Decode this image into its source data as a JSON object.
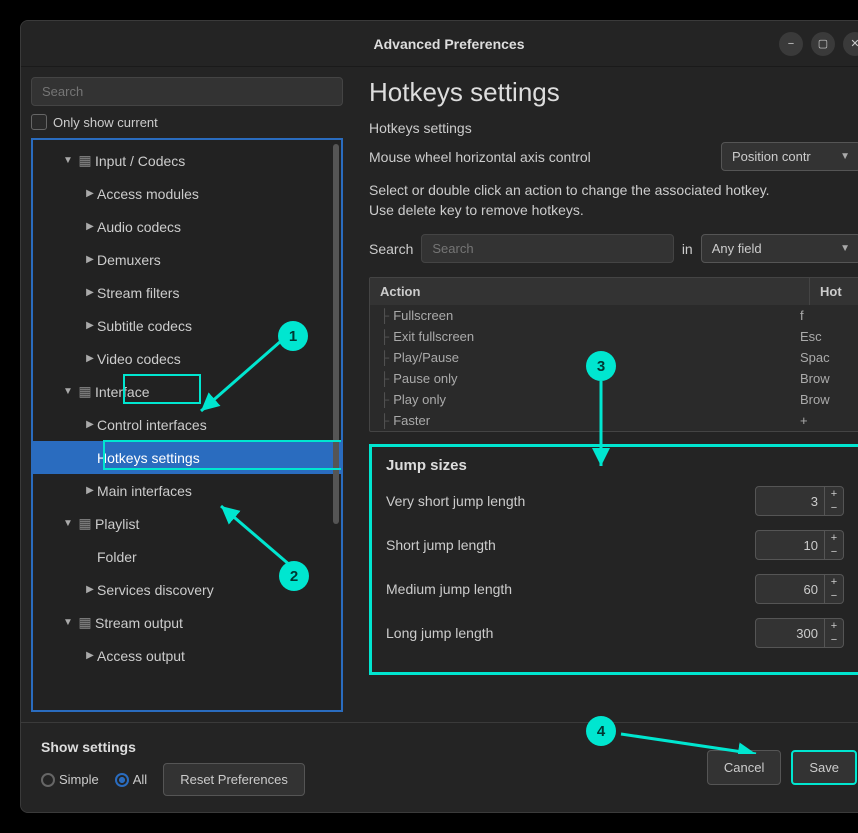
{
  "window_title": "Advanced Preferences",
  "sidebar": {
    "search_placeholder": "Search",
    "only_show_current": "Only show current",
    "tree": [
      {
        "label": "Input / Codecs",
        "expanded": true,
        "indent": 1,
        "icon": "codec"
      },
      {
        "label": "Access modules",
        "indent": 2,
        "arrow": true
      },
      {
        "label": "Audio codecs",
        "indent": 2,
        "arrow": true
      },
      {
        "label": "Demuxers",
        "indent": 2,
        "arrow": true
      },
      {
        "label": "Stream filters",
        "indent": 2,
        "arrow": true
      },
      {
        "label": "Subtitle codecs",
        "indent": 2,
        "arrow": true
      },
      {
        "label": "Video codecs",
        "indent": 2,
        "arrow": true
      },
      {
        "label": "Interface",
        "expanded": true,
        "indent": 1,
        "icon": "interface",
        "highlight": 1
      },
      {
        "label": "Control interfaces",
        "indent": 2,
        "arrow": true
      },
      {
        "label": "Hotkeys settings",
        "indent": 2,
        "selected": true,
        "highlight": 2
      },
      {
        "label": "Main interfaces",
        "indent": 2,
        "arrow": true
      },
      {
        "label": "Playlist",
        "expanded": true,
        "indent": 1,
        "icon": "playlist"
      },
      {
        "label": "Folder",
        "indent": 2
      },
      {
        "label": "Services discovery",
        "indent": 2,
        "arrow": true
      },
      {
        "label": "Stream output",
        "expanded": true,
        "indent": 1,
        "icon": "stream"
      },
      {
        "label": "Access output",
        "indent": 2,
        "arrow": true
      }
    ]
  },
  "main": {
    "title": "Hotkeys settings",
    "subtitle": "Hotkeys settings",
    "mouse_label": "Mouse wheel horizontal axis control",
    "mouse_value": "Position contr",
    "help_line1": "Select or double click an action to change the associated hotkey.",
    "help_line2": "Use delete key to remove hotkeys.",
    "search_label": "Search",
    "search_placeholder": "Search",
    "in_label": "in",
    "field_value": "Any field",
    "table": {
      "col_action": "Action",
      "col_hotkey": "Hot",
      "rows": [
        {
          "action": "Fullscreen",
          "hotkey": "f"
        },
        {
          "action": "Exit fullscreen",
          "hotkey": "Esc"
        },
        {
          "action": "Play/Pause",
          "hotkey": "Spac"
        },
        {
          "action": "Pause only",
          "hotkey": "Brow"
        },
        {
          "action": "Play only",
          "hotkey": "Brow"
        },
        {
          "action": "Faster",
          "hotkey": "+"
        }
      ]
    },
    "jump": {
      "title": "Jump sizes",
      "rows": [
        {
          "label": "Very short jump length",
          "value": "3"
        },
        {
          "label": "Short jump length",
          "value": "10"
        },
        {
          "label": "Medium jump length",
          "value": "60"
        },
        {
          "label": "Long jump length",
          "value": "300"
        }
      ]
    }
  },
  "footer": {
    "show_settings": "Show settings",
    "simple": "Simple",
    "all": "All",
    "reset": "Reset Preferences",
    "cancel": "Cancel",
    "save": "Save"
  },
  "callouts": {
    "c1": "1",
    "c2": "2",
    "c3": "3",
    "c4": "4"
  }
}
